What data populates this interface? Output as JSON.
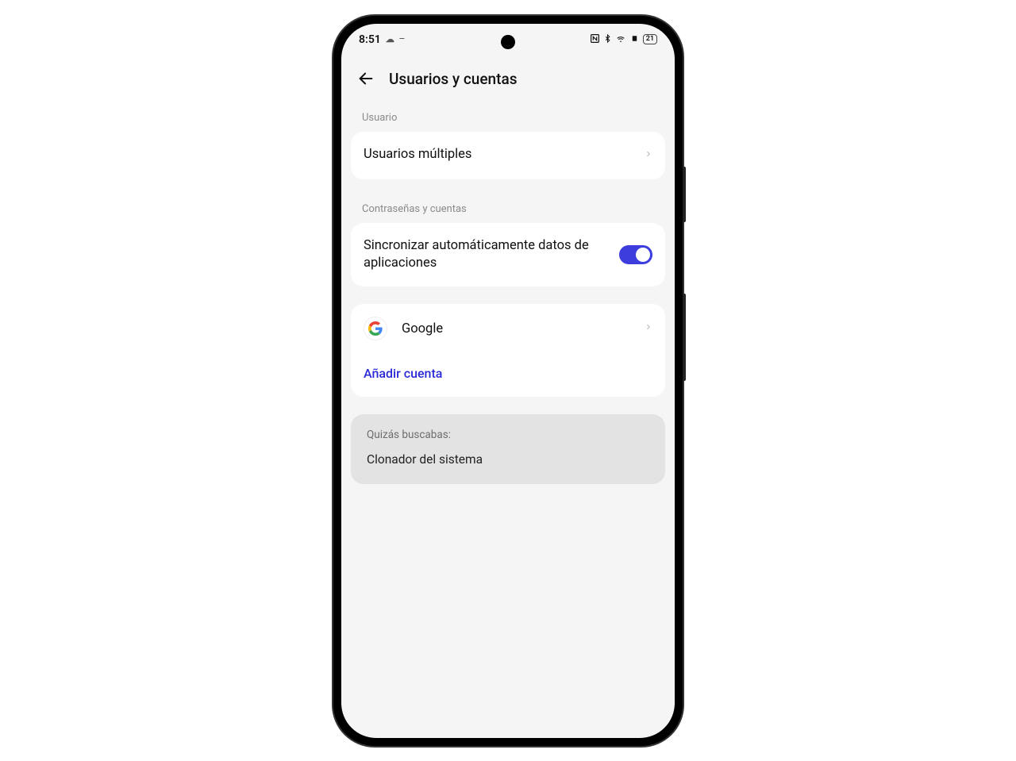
{
  "status": {
    "time": "8:51",
    "battery": "21"
  },
  "header": {
    "title": "Usuarios y cuentas"
  },
  "sections": {
    "user_label": "Usuario",
    "multi_users": "Usuarios múltiples",
    "passwords_label": "Contraseñas y cuentas",
    "auto_sync": "Sincronizar automáticamente datos de aplicaciones",
    "google": "Google",
    "add_account": "Añadir cuenta"
  },
  "suggestion": {
    "title": "Quizás buscabas:",
    "item": "Clonador del sistema"
  }
}
